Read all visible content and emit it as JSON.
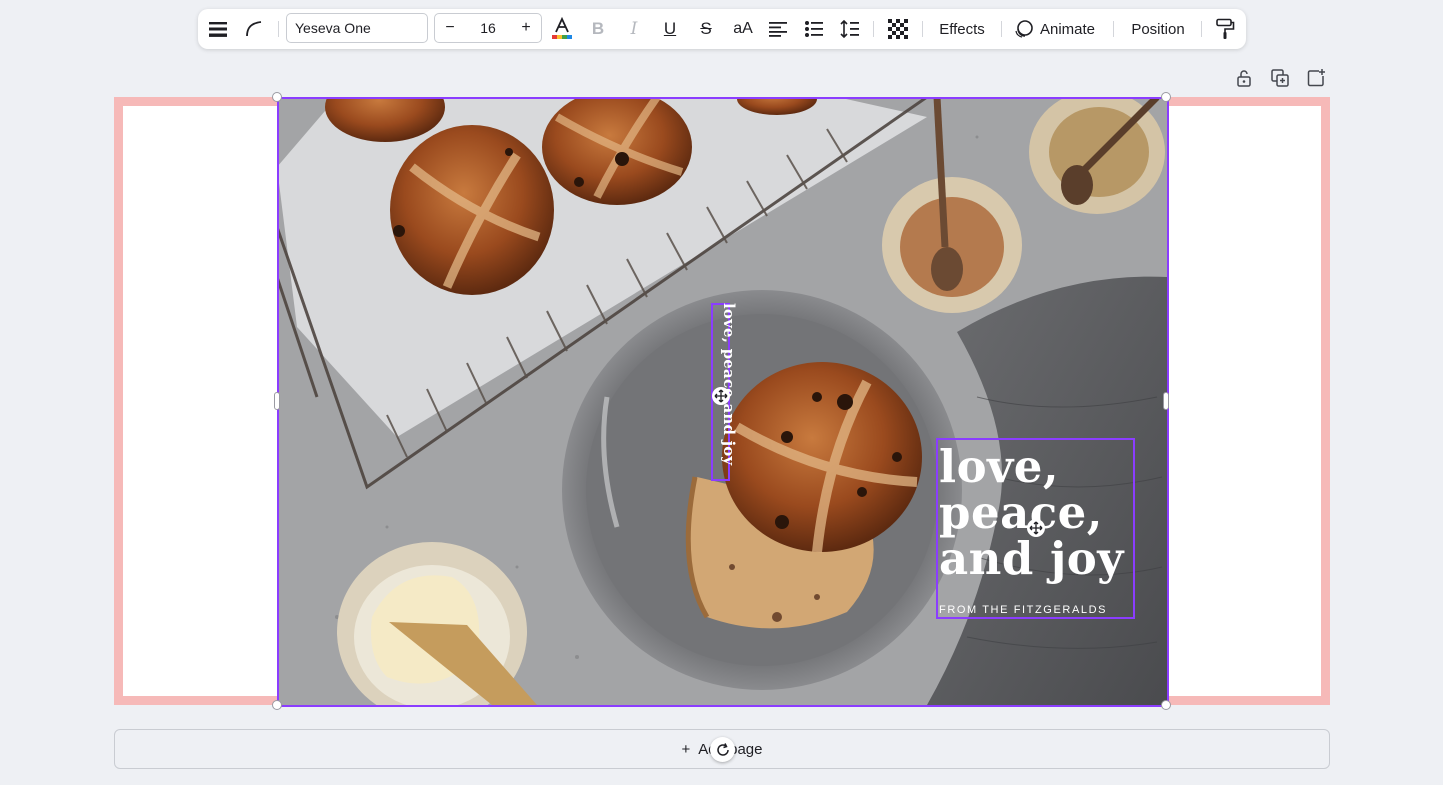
{
  "toolbar": {
    "font_family": "Yeseva One",
    "font_size": "16",
    "decrease_label": "−",
    "increase_label": "+",
    "case_label": "aA",
    "effects_label": "Effects",
    "animate_label": "Animate",
    "position_label": "Position",
    "text_color": "#111111"
  },
  "canvas": {
    "page_border_color": "#f6b9b8",
    "selection_color": "#8b3dff",
    "vertical_text": "love, peace and joy",
    "headline_lines": [
      "love,",
      "peace,",
      "and joy"
    ],
    "subline": "FROM THE FITZGERALDS"
  },
  "add_page": {
    "icon": "+",
    "label": "Add page"
  },
  "icons": {
    "menu": "menu-icon",
    "curve": "curve-text-icon",
    "lock": "unlock-icon",
    "duplicate": "duplicate-icon",
    "add": "add-element-icon",
    "paint": "paint-roller-icon"
  }
}
